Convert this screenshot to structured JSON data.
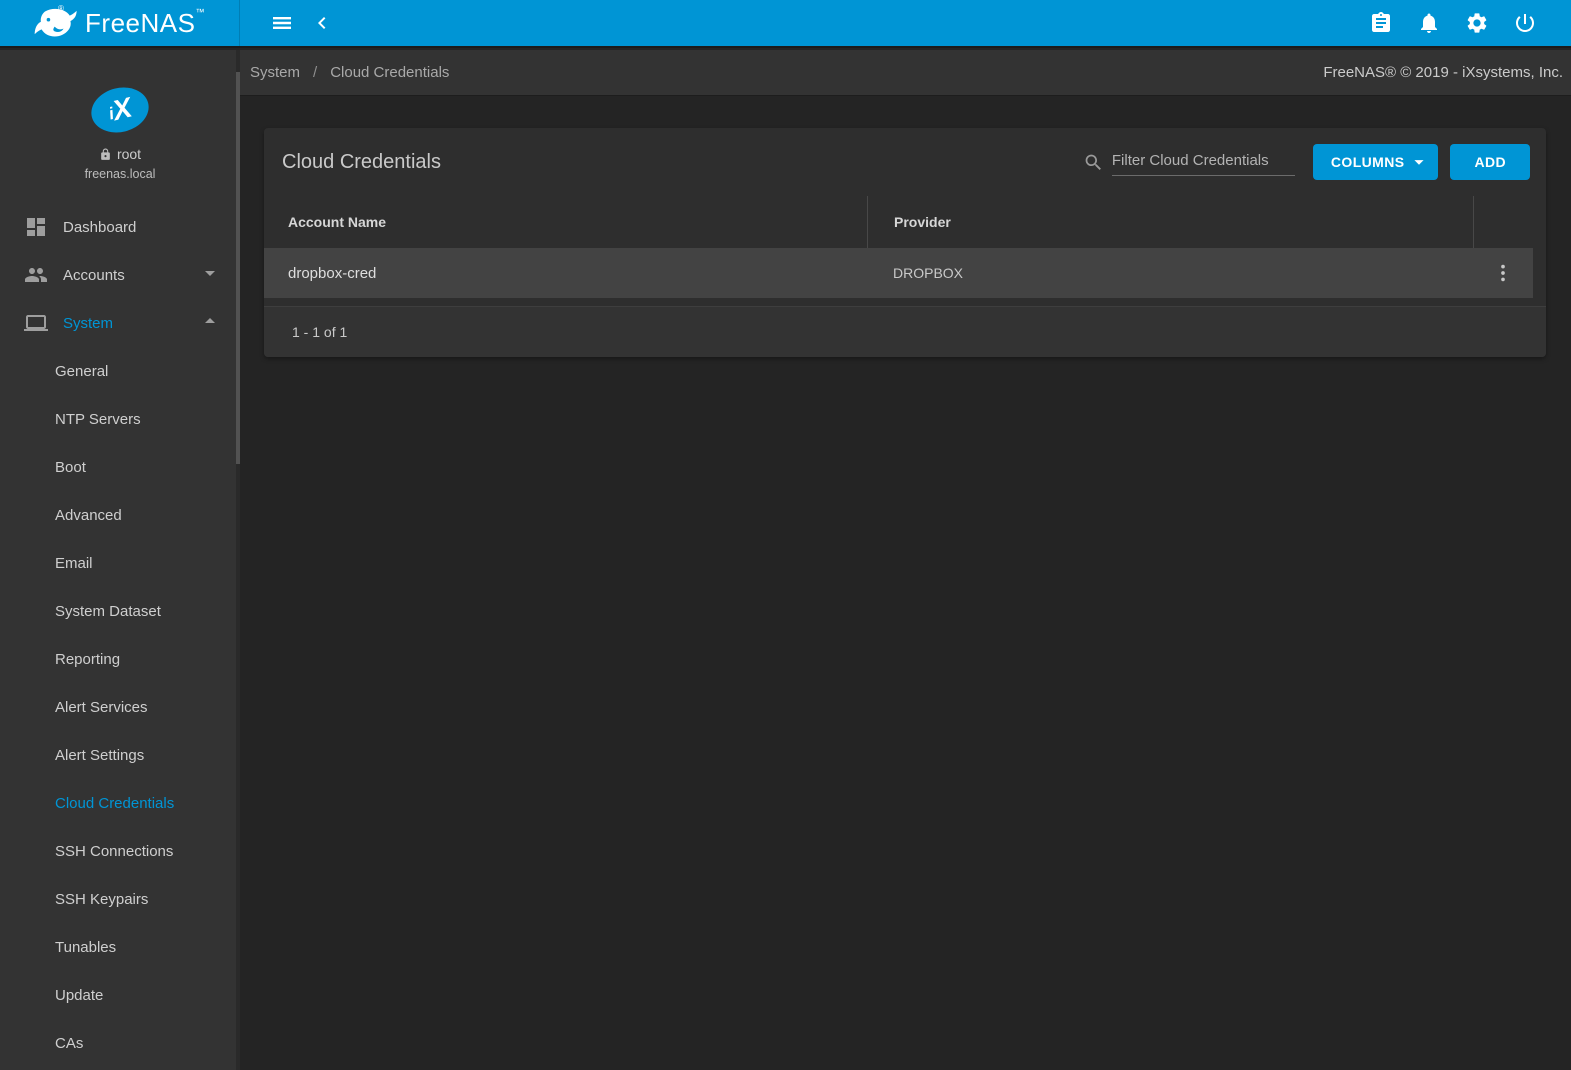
{
  "brand": {
    "name": "FreeNAS",
    "tm": "™",
    "registered": "®"
  },
  "topbar": {
    "icons": {
      "menu": "hamburger-menu",
      "back": "chevron-left",
      "tasks": "clipboard-task-manager",
      "alerts": "notification-bell",
      "settings": "gear",
      "power": "power-button"
    }
  },
  "breadcrumb": {
    "section": "System",
    "separator": "/",
    "page": "Cloud Credentials",
    "copyright": "FreeNAS® © 2019 - iXsystems, Inc."
  },
  "sidebar": {
    "avatar": {
      "i": "i",
      "x": "X"
    },
    "username": "root",
    "hostname": "freenas.local",
    "top_items": [
      {
        "label": "Dashboard",
        "icon": "dashboard-grid",
        "caret": "none",
        "active": false
      },
      {
        "label": "Accounts",
        "icon": "people",
        "caret": "down",
        "active": false
      },
      {
        "label": "System",
        "icon": "laptop",
        "caret": "up",
        "active": true
      }
    ],
    "system_children": [
      "General",
      "NTP Servers",
      "Boot",
      "Advanced",
      "Email",
      "System Dataset",
      "Reporting",
      "Alert Services",
      "Alert Settings",
      "Cloud Credentials",
      "SSH Connections",
      "SSH Keypairs",
      "Tunables",
      "Update",
      "CAs"
    ],
    "active_child": "Cloud Credentials"
  },
  "main": {
    "card_title": "Cloud Credentials",
    "filter_placeholder": "Filter Cloud Credentials",
    "filter_value": "",
    "columns_button": "COLUMNS",
    "add_button": "ADD",
    "table": {
      "headers": [
        "Account Name",
        "Provider"
      ],
      "rows": [
        {
          "account_name": "dropbox-cred",
          "provider": "DROPBOX"
        }
      ]
    },
    "paginator": "1 - 1 of 1"
  },
  "colors": {
    "primary": "#0095d5",
    "topbar_bg": "#0095d5",
    "sidebar_bg": "#333333",
    "page_bg": "#242424",
    "card_bg": "#2e2e2e",
    "row_bg": "#434343",
    "footer_bg": "#333333"
  }
}
